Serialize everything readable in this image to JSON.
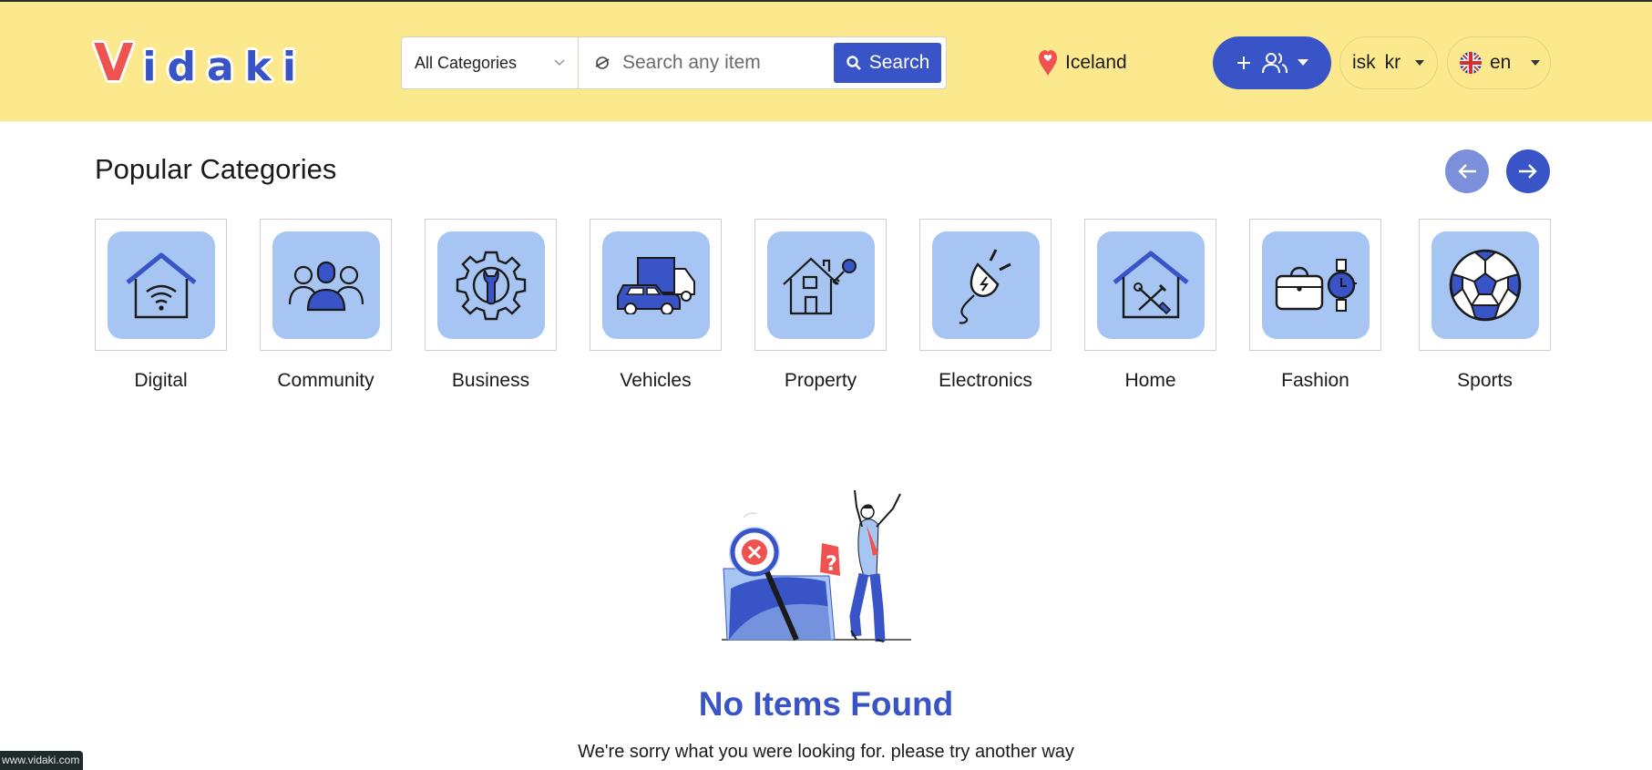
{
  "brand": {
    "logo_first": "V",
    "logo_rest": [
      "i",
      "d",
      "a",
      "k",
      "i"
    ],
    "primary_color": "#3954c6",
    "header_color": "#fde98d",
    "tile_color": "#a6c5f2"
  },
  "header": {
    "category_select": "All Categories",
    "search_placeholder": "Search any item",
    "search_button": "Search",
    "location": "Iceland",
    "currency": [
      "isk",
      "kr"
    ],
    "language": "en"
  },
  "popular": {
    "title": "Popular Categories",
    "categories": [
      {
        "label": "Digital",
        "icon": "wifi-house-icon"
      },
      {
        "label": "Community",
        "icon": "people-group-icon"
      },
      {
        "label": "Business",
        "icon": "gear-wrench-icon"
      },
      {
        "label": "Vehicles",
        "icon": "car-truck-icon"
      },
      {
        "label": "Property",
        "icon": "house-key-icon"
      },
      {
        "label": "Electronics",
        "icon": "plug-icon"
      },
      {
        "label": "Home",
        "icon": "house-tools-icon"
      },
      {
        "label": "Fashion",
        "icon": "bag-watch-icon"
      },
      {
        "label": "Sports",
        "icon": "soccer-ball-icon"
      }
    ]
  },
  "empty": {
    "title": "No Items Found",
    "message": "We're sorry what you were looking for. please try another way"
  },
  "status_bar": {
    "url": "www.vidaki.com"
  }
}
